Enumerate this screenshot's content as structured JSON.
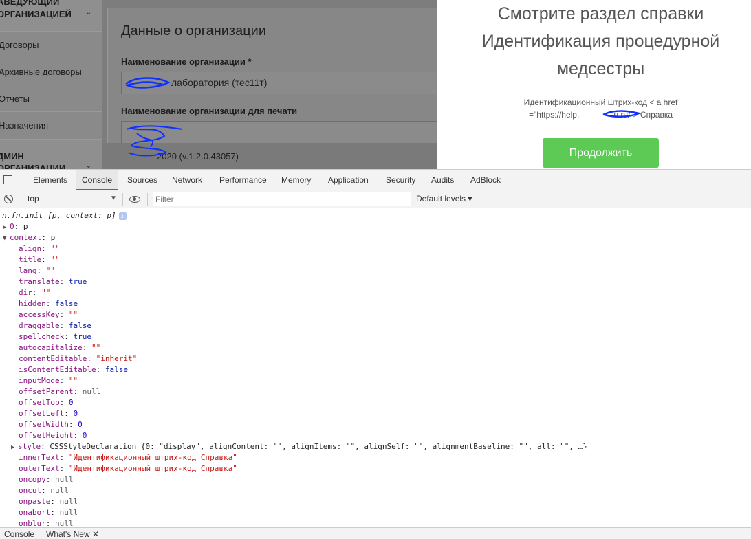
{
  "sidebar": {
    "section1": [
      "АВЕДУЮЩИЙ",
      "ОРГАНИЗАЦИЕЙ"
    ],
    "items": [
      "Договоры",
      "Архивные договоры",
      "Отчеты",
      "Назначения"
    ],
    "section2": [
      "ДМИН",
      "ОРГАНИЗАЦИИ"
    ]
  },
  "form": {
    "title": "Данные о организации",
    "org_name_label": "Наименование организации *",
    "org_name_value": "лаборатория (тес11т)",
    "print_name_label": "Наименование организации для печати",
    "version": "2020 (v.1.2.0.43057)"
  },
  "modal": {
    "title_lines": [
      "Смотрите раздел справки",
      "Идентификация процедурной",
      "медсестры"
    ],
    "text_line1": "Идентификационный штрих-код < a href",
    "text_line2": "=\"https://help.",
    "text_line2_end": "u.ru/\"> Справка",
    "button": "Продолжить"
  },
  "devtools": {
    "tabs": [
      "Elements",
      "Console",
      "Sources",
      "Network",
      "Performance",
      "Memory",
      "Application",
      "Security",
      "Audits",
      "AdBlock"
    ],
    "active_tab": "Console",
    "context": "top",
    "filter_placeholder": "Filter",
    "levels": "Default levels ▾",
    "drawer_tabs": [
      "Console",
      "What's New ✕"
    ]
  },
  "console": {
    "header": "n.fn.init [p, context: p]",
    "item0": [
      "0",
      "p"
    ],
    "context": [
      "context",
      "p"
    ],
    "props": [
      [
        "align",
        "\"\"",
        "str"
      ],
      [
        "title",
        "\"\"",
        "str"
      ],
      [
        "lang",
        "\"\"",
        "str"
      ],
      [
        "translate",
        "true",
        "kw"
      ],
      [
        "dir",
        "\"\"",
        "str"
      ],
      [
        "hidden",
        "false",
        "kw"
      ],
      [
        "accessKey",
        "\"\"",
        "str"
      ],
      [
        "draggable",
        "false",
        "kw"
      ],
      [
        "spellcheck",
        "true",
        "kw"
      ],
      [
        "autocapitalize",
        "\"\"",
        "str"
      ],
      [
        "contentEditable",
        "\"inherit\"",
        "str"
      ],
      [
        "isContentEditable",
        "false",
        "kw"
      ],
      [
        "inputMode",
        "\"\"",
        "str"
      ],
      [
        "offsetParent",
        "null",
        "null"
      ],
      [
        "offsetTop",
        "0",
        "num"
      ],
      [
        "offsetLeft",
        "0",
        "num"
      ],
      [
        "offsetWidth",
        "0",
        "num"
      ],
      [
        "offsetHeight",
        "0",
        "num"
      ]
    ],
    "style_line": [
      "style",
      "CSSStyleDeclaration {0: \"display\", alignContent: \"\", alignItems: \"\", alignSelf: \"\", alignmentBaseline: \"\", all: \"\", …}"
    ],
    "props2": [
      [
        "innerText",
        "\"Идентификационный штрих-код Справка\"",
        "str"
      ],
      [
        "outerText",
        "\"Идентификационный штрих-код Справка\"",
        "str"
      ],
      [
        "oncopy",
        "null",
        "null"
      ],
      [
        "oncut",
        "null",
        "null"
      ],
      [
        "onpaste",
        "null",
        "null"
      ],
      [
        "onabort",
        "null",
        "null"
      ],
      [
        "onblur",
        "null",
        "null"
      ]
    ]
  }
}
